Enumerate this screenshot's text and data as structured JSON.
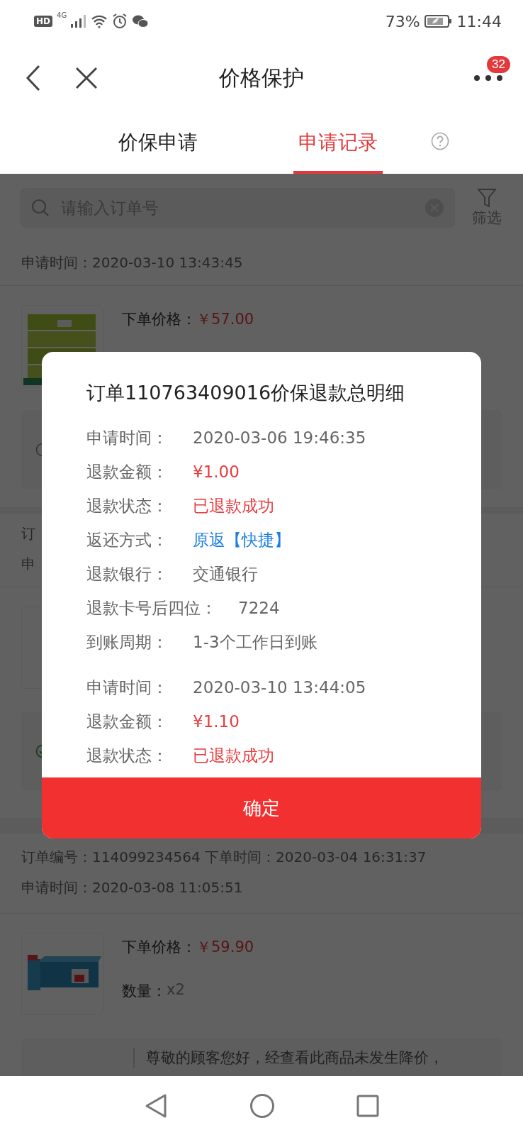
{
  "status_bar": {
    "hd": "HD",
    "network": "4G",
    "battery": "73%",
    "time": "11:44"
  },
  "header": {
    "title": "价格保护",
    "badge": "32"
  },
  "tabs": [
    {
      "label": "价保申请",
      "selected": false
    },
    {
      "label": "申请记录",
      "selected": true
    }
  ],
  "search": {
    "placeholder": "请输入订单号",
    "filter_label": "筛选"
  },
  "records": [
    {
      "lines": [
        "申请时间：2020-03-10 13:43:45"
      ],
      "product": {
        "price_label": "下单价格：",
        "price": "￥57.00"
      }
    },
    {
      "lines": [
        "订",
        "申"
      ]
    },
    {
      "lines": [
        "订单编号：114099234564 下单时间：2020-03-04 16:31:37",
        "申请时间：2020-03-08 11:05:51"
      ],
      "product": {
        "price_label": "下单价格：",
        "price": "￥59.90",
        "qty_label": "数量：",
        "qty": "x2"
      },
      "notice": {
        "text": "尊敬的顾客您好，经查看此商品未发生降价，"
      }
    }
  ],
  "modal": {
    "title": "订单110763409016价保退款总明细",
    "groups": [
      [
        {
          "label": "申请时间：",
          "value": "2020-03-06 19:46:35",
          "color": "#666666"
        },
        {
          "label": "退款金额：",
          "value": "¥1.00",
          "color": "#e93b3d"
        },
        {
          "label": "退款状态：",
          "value": "已退款成功",
          "color": "#e93b3d"
        },
        {
          "label": "返还方式：",
          "value": "原返【快捷】",
          "color": "#1a7ee6"
        },
        {
          "label": "退款银行：",
          "value": "交通银行",
          "color": "#666666"
        },
        {
          "label": "退款卡号后四位：",
          "value": "7224",
          "color": "#666666"
        },
        {
          "label": "到账周期：",
          "value": "1-3个工作日到账",
          "color": "#666666"
        }
      ],
      [
        {
          "label": "申请时间：",
          "value": "2020-03-10 13:44:05",
          "color": "#666666"
        },
        {
          "label": "退款金额：",
          "value": "¥1.10",
          "color": "#e93b3d"
        },
        {
          "label": "退款状态：",
          "value": "已退款成功",
          "color": "#e93b3d"
        }
      ]
    ],
    "confirm": "确定"
  }
}
